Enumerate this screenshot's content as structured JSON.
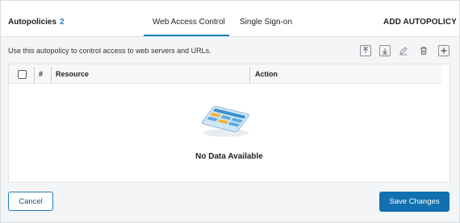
{
  "header": {
    "title": "Autopolicies",
    "count": "2",
    "tabs": [
      {
        "label": "Web Access Control",
        "active": true
      },
      {
        "label": "Single Sign-on",
        "active": false
      }
    ],
    "add_label": "ADD AUTOPOLICY"
  },
  "description": "Use this autopolicy to control access to web servers and URLs.",
  "toolbar": {
    "icons": [
      "move-up-icon",
      "move-down-icon",
      "edit-icon",
      "delete-icon",
      "add-icon"
    ]
  },
  "table": {
    "columns": [
      "#",
      "Resource",
      "Action"
    ],
    "empty_text": "No Data Available"
  },
  "footer": {
    "cancel_label": "Cancel",
    "save_label": "Save Changes"
  },
  "colors": {
    "accent": "#1a7fc1",
    "primary_button": "#1170b0"
  }
}
